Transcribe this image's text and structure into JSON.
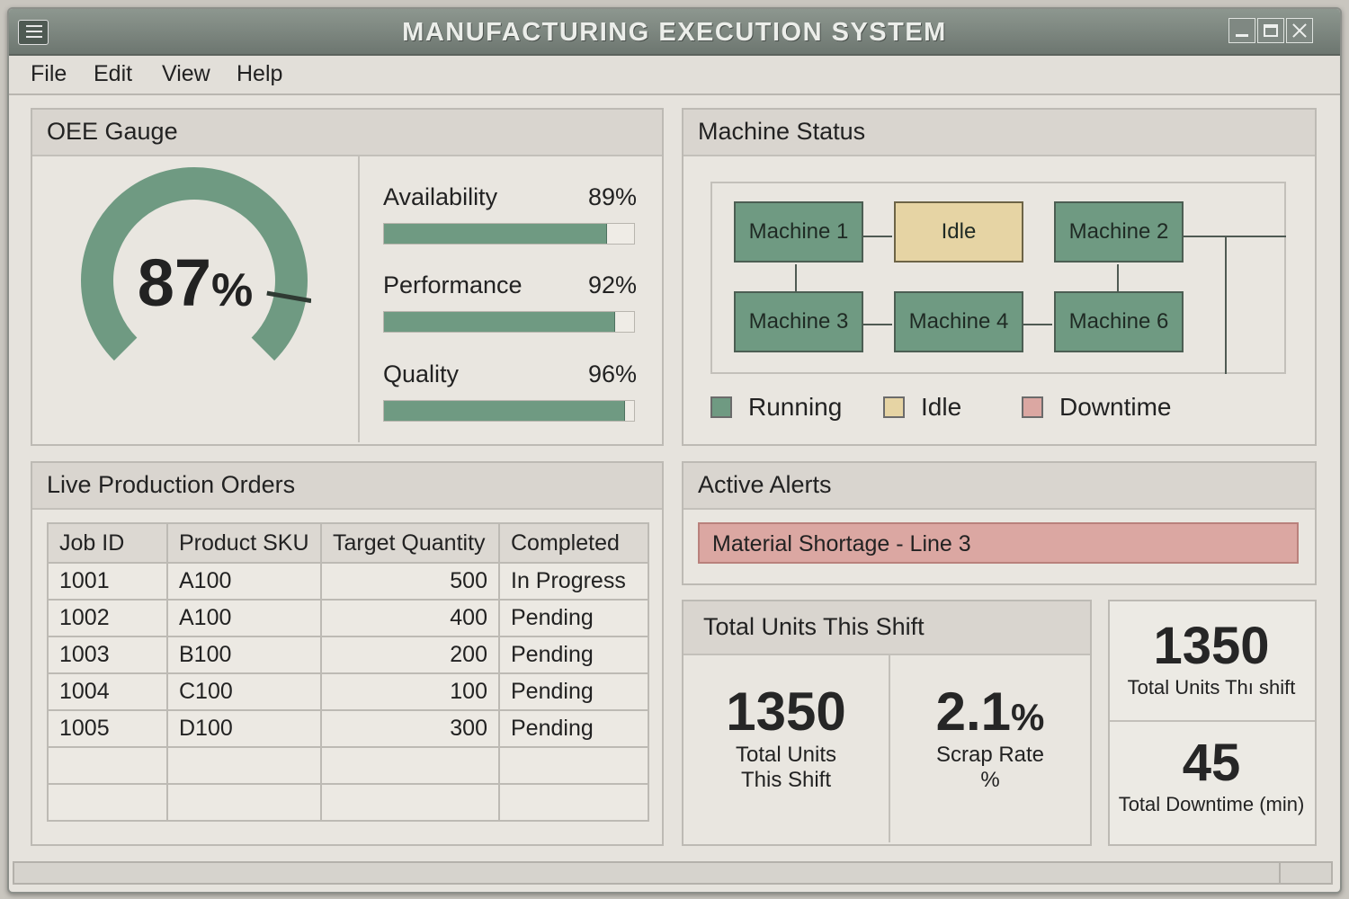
{
  "window": {
    "title": "MANUFACTURING EXECUTION SYSTEM",
    "icons": {
      "app": "list-icon",
      "minimize": "minimize-icon",
      "maximize": "maximize-icon",
      "close": "close-icon"
    }
  },
  "menu": [
    "File",
    "Edit",
    "View",
    "Help"
  ],
  "oee": {
    "title": "OEE Gauge",
    "value": "87",
    "unit": "%",
    "gauge_fraction": 0.87,
    "metrics": [
      {
        "label": "Availability",
        "value": "89%",
        "fraction": 0.89
      },
      {
        "label": "Performance",
        "value": "92%",
        "fraction": 0.92
      },
      {
        "label": "Quality",
        "value": "96%",
        "fraction": 0.96
      }
    ]
  },
  "machine_status": {
    "title": "Machine Status",
    "machines": [
      {
        "label": "Machine 1",
        "status": "running"
      },
      {
        "label": "Idle",
        "status": "idle"
      },
      {
        "label": "Machine 2",
        "status": "running"
      },
      {
        "label": "Machine 3",
        "status": "running"
      },
      {
        "label": "Machine 4",
        "status": "running"
      },
      {
        "label": "Machine 6",
        "status": "running"
      }
    ],
    "legend": [
      {
        "label": "Running",
        "color": "#6f9a82"
      },
      {
        "label": "Idle",
        "color": "#e6d4a4"
      },
      {
        "label": "Downtime",
        "color": "#dba7a2"
      }
    ]
  },
  "orders": {
    "title": "Live Production Orders",
    "columns": [
      "Job ID",
      "Product SKU",
      "Target Quantity",
      "Completed"
    ],
    "rows": [
      [
        "1001",
        "A100",
        "500",
        "In Progress"
      ],
      [
        "1002",
        "A100",
        "400",
        "Pending"
      ],
      [
        "1003",
        "B100",
        "200",
        "Pending"
      ],
      [
        "1004",
        "C100",
        "100",
        "Pending"
      ],
      [
        "1005",
        "D100",
        "300",
        "Pending"
      ],
      [
        "",
        "",
        "",
        ""
      ],
      [
        "",
        "",
        "",
        ""
      ]
    ]
  },
  "alerts": {
    "title": "Active Alerts",
    "items": [
      "Material Shortage - Line 3"
    ]
  },
  "shift": {
    "title": "Total Units This Shift",
    "units_value": "1350",
    "units_label": "Total Units\nThis Shift",
    "scrap_value": "2.1",
    "scrap_unit": "%",
    "scrap_label": "Scrap Rate\n%"
  },
  "side_kpis": {
    "units_value": "1350",
    "units_label": "Total Units Thı shift",
    "downtime_value": "45",
    "downtime_label": "Total Downtime (min)"
  },
  "colors": {
    "running": "#6f9a82",
    "idle": "#e6d4a4",
    "downtime": "#dba7a2",
    "titlebar": "#7a847d"
  }
}
